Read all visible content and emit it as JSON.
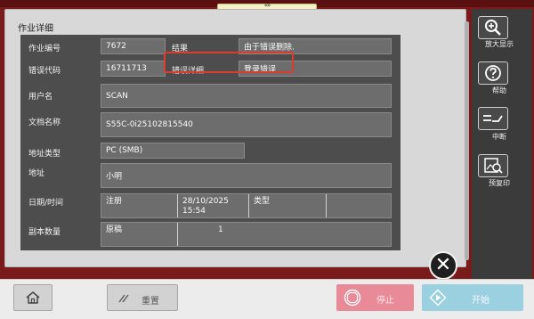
{
  "sheet": {
    "title": "作业详细"
  },
  "header": {
    "scroll_indicator": "«»"
  },
  "fields": {
    "job_number": {
      "label": "作业编号",
      "value": "7672"
    },
    "result": {
      "label": "结果",
      "value": "由于错误删除."
    },
    "error_code": {
      "label": "错误代码",
      "value": "16711713"
    },
    "error_detail": {
      "label": "错误详细",
      "value": "登录错误"
    },
    "user_name": {
      "label": "用户名",
      "value": "SCAN"
    },
    "document_name": {
      "label": "文档名称",
      "value": "S55C-0i25102815540"
    },
    "address_type": {
      "label": "地址类型",
      "value": "PC (SMB)"
    },
    "address": {
      "label": "地址",
      "value": "小明"
    },
    "date_time": {
      "label": "日期/时间",
      "sub_label": "注册",
      "date": "28/10/2025",
      "time": "15:54",
      "type_label": "类型",
      "type_value": ""
    },
    "copies": {
      "label": "副本数量",
      "sub_label": "原稿",
      "value": "1"
    }
  },
  "side_buttons": [
    {
      "label": "放大显示",
      "icon": "zoom-in-icon"
    },
    {
      "label": "帮助",
      "icon": "help-icon"
    },
    {
      "label": "中断",
      "icon": "interrupt-icon"
    },
    {
      "label": "预复印",
      "icon": "preview-copy-icon"
    }
  ],
  "bottom_bar": {
    "home_icon": "home-icon",
    "reset_label": "重置",
    "stop_label": "停止",
    "start_label": "开始"
  },
  "colors": {
    "bezel": "#7a1a1a",
    "panel": "#4d4d4d",
    "highlight": "#e03a2f",
    "stop": "#e88a98",
    "start": "#9bd0e0"
  }
}
